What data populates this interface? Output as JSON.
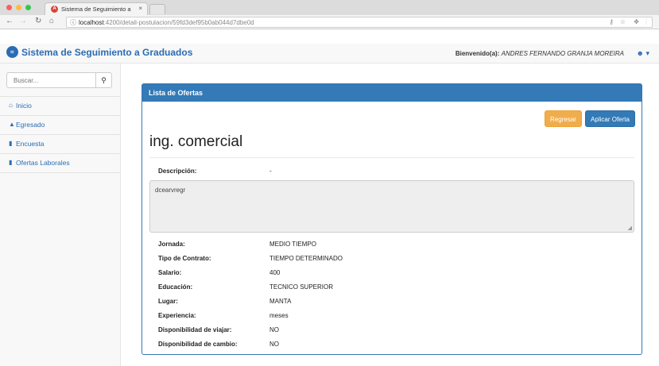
{
  "browser": {
    "tab_title": "Sistema de Seguimiento a Gra",
    "tab_close": "×",
    "url_host": "localhost",
    "url_rest": ":4200/detail-postulacion/59fd3def95b0ab044d7dbe0d",
    "traffic_colors": [
      "#fc605c",
      "#fdbc40",
      "#34c84a"
    ]
  },
  "navbar": {
    "brand": "Sistema de Seguimiento a Graduados",
    "welcome_label": "Bienvenido(a):",
    "user_name": "ANDRES FERNANDO GRANJA MOREIRA",
    "accent_color": "#2b6cb3"
  },
  "sidebar": {
    "search_placeholder": "Buscar...",
    "items": [
      {
        "label": "Inicio",
        "icon": "home-icon"
      },
      {
        "label": "Egresado",
        "icon": "graduation-cap-icon"
      },
      {
        "label": "Encuesta",
        "icon": "file-icon"
      },
      {
        "label": "Ofertas Laborales",
        "icon": "file-icon"
      }
    ]
  },
  "panel": {
    "heading": "Lista de Ofertas",
    "back_label": "Regresar",
    "apply_label": "Aplicar Oferta",
    "offer_title": "ing. comercial",
    "description_label": "Descripción:",
    "description_value": "-",
    "description_text": "dcearvregr",
    "details": [
      {
        "label": "Jornada:",
        "value": "MEDIO TIEMPO"
      },
      {
        "label": "Tipo de Contrato:",
        "value": "TIEMPO DETERMINADO"
      },
      {
        "label": "Salario:",
        "value": "400"
      },
      {
        "label": "Educación:",
        "value": "TECNICO SUPERIOR"
      },
      {
        "label": "Lugar:",
        "value": "MANTA"
      },
      {
        "label": "Experiencia:",
        "value": "meses"
      },
      {
        "label": "Disponibilidad de viajar:",
        "value": "NO"
      },
      {
        "label": "Disponibilidad de cambio:",
        "value": "NO"
      }
    ]
  }
}
